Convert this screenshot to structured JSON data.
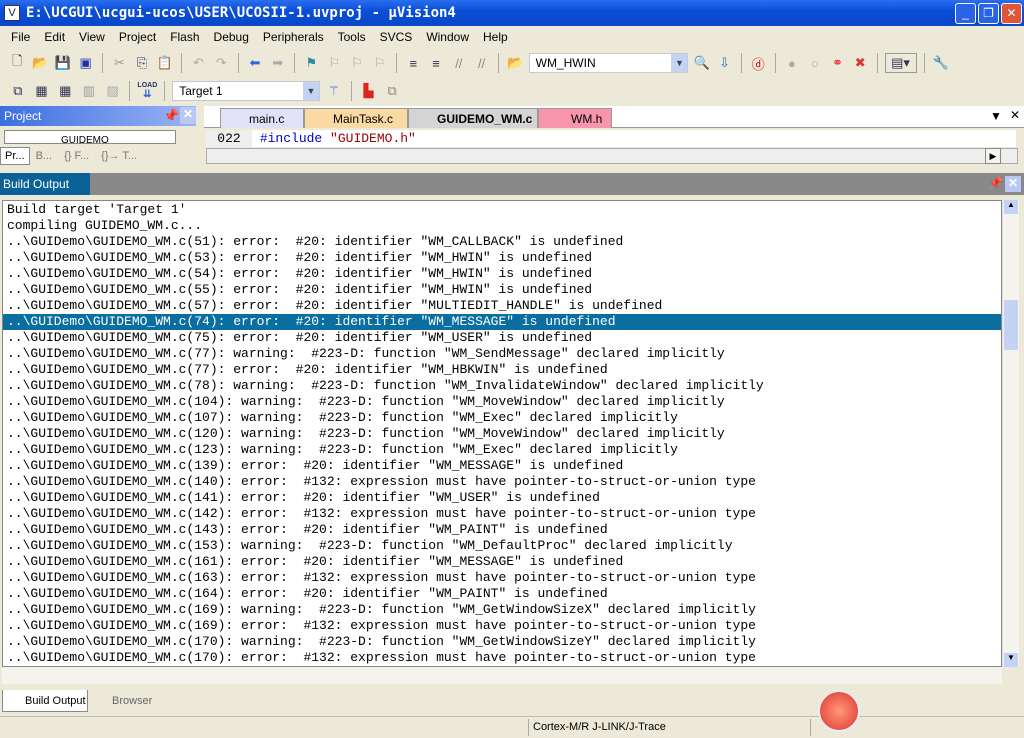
{
  "window": {
    "title": "E:\\UCGUI\\ucgui-ucos\\USER\\UCOSII-1.uvproj - µVision4"
  },
  "menu": [
    "File",
    "Edit",
    "View",
    "Project",
    "Flash",
    "Debug",
    "Peripherals",
    "Tools",
    "SVCS",
    "Window",
    "Help"
  ],
  "toolbar": {
    "find_value": "WM_HWIN",
    "target_value": "Target 1",
    "load_label": "LOAD"
  },
  "project_panel": {
    "title": "Project",
    "tree_item": "GUIDEMO",
    "tabs": [
      "Pr...",
      "B...",
      "{} F...",
      "{}→ T..."
    ]
  },
  "editor": {
    "tabs": [
      "main.c",
      "MainTask.c",
      "GUIDEMO_WM.c",
      "WM.h"
    ],
    "active_tab": "GUIDEMO_WM.c",
    "line_no": "022",
    "code_directive": "#include",
    "code_string": "\"GUIDEMO.h\""
  },
  "build_output": {
    "title": "Build Output",
    "selected_index": 7,
    "lines": [
      "Build target 'Target 1'",
      "compiling GUIDEMO_WM.c...",
      "..\\GUIDemo\\GUIDEMO_WM.c(51): error:  #20: identifier \"WM_CALLBACK\" is undefined",
      "..\\GUIDemo\\GUIDEMO_WM.c(53): error:  #20: identifier \"WM_HWIN\" is undefined",
      "..\\GUIDemo\\GUIDEMO_WM.c(54): error:  #20: identifier \"WM_HWIN\" is undefined",
      "..\\GUIDemo\\GUIDEMO_WM.c(55): error:  #20: identifier \"WM_HWIN\" is undefined",
      "..\\GUIDemo\\GUIDEMO_WM.c(57): error:  #20: identifier \"MULTIEDIT_HANDLE\" is undefined",
      "..\\GUIDemo\\GUIDEMO_WM.c(74): error:  #20: identifier \"WM_MESSAGE\" is undefined",
      "..\\GUIDemo\\GUIDEMO_WM.c(75): error:  #20: identifier \"WM_USER\" is undefined",
      "..\\GUIDemo\\GUIDEMO_WM.c(77): warning:  #223-D: function \"WM_SendMessage\" declared implicitly",
      "..\\GUIDemo\\GUIDEMO_WM.c(77): error:  #20: identifier \"WM_HBKWIN\" is undefined",
      "..\\GUIDemo\\GUIDEMO_WM.c(78): warning:  #223-D: function \"WM_InvalidateWindow\" declared implicitly",
      "..\\GUIDemo\\GUIDEMO_WM.c(104): warning:  #223-D: function \"WM_MoveWindow\" declared implicitly",
      "..\\GUIDemo\\GUIDEMO_WM.c(107): warning:  #223-D: function \"WM_Exec\" declared implicitly",
      "..\\GUIDemo\\GUIDEMO_WM.c(120): warning:  #223-D: function \"WM_MoveWindow\" declared implicitly",
      "..\\GUIDemo\\GUIDEMO_WM.c(123): warning:  #223-D: function \"WM_Exec\" declared implicitly",
      "..\\GUIDemo\\GUIDEMO_WM.c(139): error:  #20: identifier \"WM_MESSAGE\" is undefined",
      "..\\GUIDemo\\GUIDEMO_WM.c(140): error:  #132: expression must have pointer-to-struct-or-union type",
      "..\\GUIDemo\\GUIDEMO_WM.c(141): error:  #20: identifier \"WM_USER\" is undefined",
      "..\\GUIDemo\\GUIDEMO_WM.c(142): error:  #132: expression must have pointer-to-struct-or-union type",
      "..\\GUIDemo\\GUIDEMO_WM.c(143): error:  #20: identifier \"WM_PAINT\" is undefined",
      "..\\GUIDemo\\GUIDEMO_WM.c(153): warning:  #223-D: function \"WM_DefaultProc\" declared implicitly",
      "..\\GUIDemo\\GUIDEMO_WM.c(161): error:  #20: identifier \"WM_MESSAGE\" is undefined",
      "..\\GUIDemo\\GUIDEMO_WM.c(163): error:  #132: expression must have pointer-to-struct-or-union type",
      "..\\GUIDemo\\GUIDEMO_WM.c(164): error:  #20: identifier \"WM_PAINT\" is undefined",
      "..\\GUIDemo\\GUIDEMO_WM.c(169): warning:  #223-D: function \"WM_GetWindowSizeX\" declared implicitly",
      "..\\GUIDemo\\GUIDEMO_WM.c(169): error:  #132: expression must have pointer-to-struct-or-union type",
      "..\\GUIDemo\\GUIDEMO_WM.c(170): warning:  #223-D: function \"WM_GetWindowSizeY\" declared implicitly",
      "..\\GUIDemo\\GUIDEMO_WM.c(170): error:  #132: expression must have pointer-to-struct-or-union type"
    ]
  },
  "bottom_tabs": [
    "Build Output",
    "Browser"
  ],
  "status": {
    "debugger": "Cortex-M/R J-LINK/J-Trace"
  }
}
